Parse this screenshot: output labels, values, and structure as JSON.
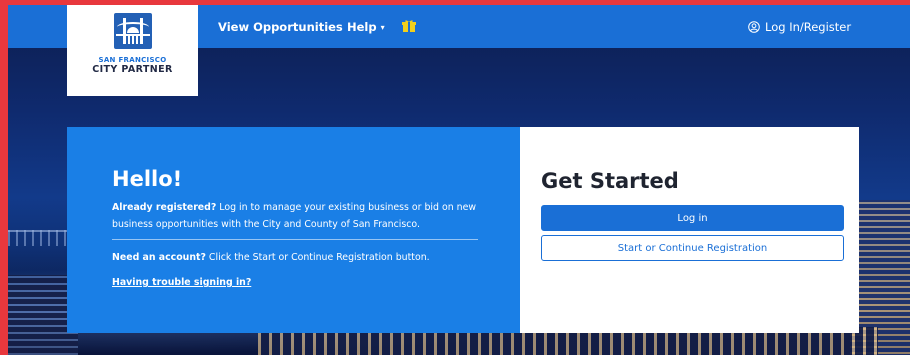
{
  "logo": {
    "line1": "SAN FRANCISCO",
    "line2": "CITY PARTNER"
  },
  "nav": {
    "view_opportunities": "View Opportunities",
    "help": "Help",
    "help_caret": "▾",
    "login_register": "Log In/Register"
  },
  "hello_panel": {
    "title": "Hello!",
    "registered_bold": "Already registered?",
    "registered_text": " Log in to manage your existing business or bid on new business opportunities with the City and County of San Francisco.",
    "account_bold": "Need an account?",
    "account_text": " Click the Start or Continue Registration button.",
    "trouble_link": "Having trouble signing in?"
  },
  "get_started_panel": {
    "title": "Get Started",
    "login_button": "Log in",
    "registration_button": "Start or Continue Registration"
  },
  "colors": {
    "nav_blue": "#1a6fd6",
    "panel_blue": "#1a7fe6",
    "gift_yellow": "#f2d01c",
    "border_red": "#e8383d"
  }
}
